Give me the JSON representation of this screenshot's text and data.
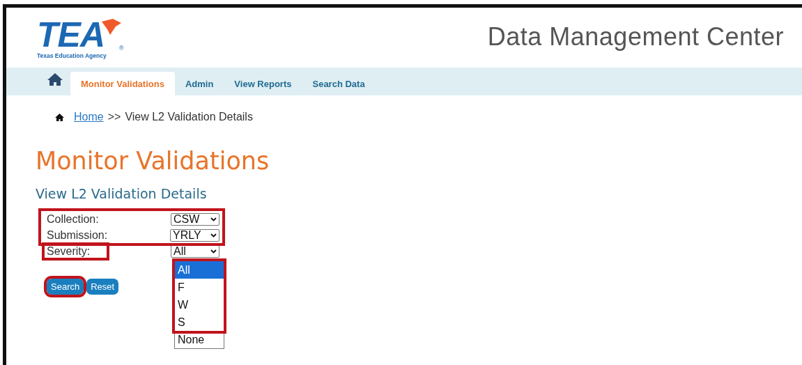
{
  "logo": {
    "mark": "TEA",
    "caption": "Texas Education Agency",
    "registered": "®"
  },
  "header": {
    "title": "Data Management Center"
  },
  "nav": [
    {
      "kind": "home",
      "selected": false
    },
    {
      "kind": "link",
      "label": "Monitor Validations",
      "selected": true
    },
    {
      "kind": "link",
      "label": "Admin",
      "selected": false
    },
    {
      "kind": "link",
      "label": "View Reports",
      "selected": false
    },
    {
      "kind": "link",
      "label": "Search Data",
      "selected": false
    }
  ],
  "breadcrumb": {
    "link": "Home",
    "separator": ">>",
    "current": "View L2 Validation Details"
  },
  "page_title": "Monitor Validations",
  "subtitle": "View L2 Validation Details",
  "fields": [
    {
      "label": "Collection:",
      "value": "CSW",
      "highlighted": true
    },
    {
      "label": "Submission:",
      "value": "YRLY",
      "highlighted": true
    },
    {
      "label": "Severity:",
      "value": "All",
      "highlighted": false,
      "label_highlighted": true,
      "expanded": true
    }
  ],
  "dropdown_options": [
    {
      "label": "All",
      "selected": true,
      "highlighted": true
    },
    {
      "label": "F",
      "selected": false,
      "highlighted": true
    },
    {
      "label": "W",
      "selected": false,
      "highlighted": true
    },
    {
      "label": "S",
      "selected": false,
      "highlighted": true
    },
    {
      "label": "None",
      "selected": false,
      "highlighted": false
    }
  ],
  "buttons": [
    {
      "label": "Search",
      "highlighted": true
    },
    {
      "label": "Reset",
      "highlighted": false
    }
  ]
}
